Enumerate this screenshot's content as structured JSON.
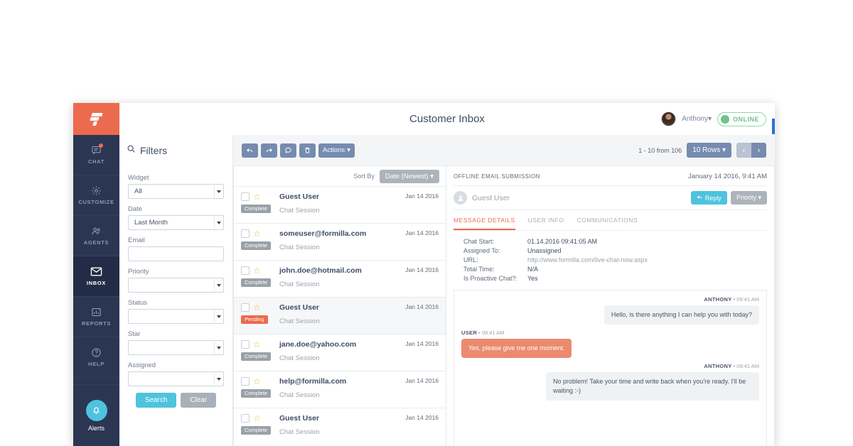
{
  "brand": {
    "accent": "#ec6a4d",
    "teal": "#4ec3dd",
    "navy": "#2b3653",
    "logo_name": "formilla-logo"
  },
  "sidebar": {
    "items": [
      {
        "label": "CHAT",
        "icon": "chat-bubble-icon",
        "active": false,
        "dot": true
      },
      {
        "label": "CUSTOMIZE",
        "icon": "gear-icon",
        "active": false,
        "dot": false
      },
      {
        "label": "AGENTS",
        "icon": "agents-icon",
        "active": false,
        "dot": false
      },
      {
        "label": "INBOX",
        "icon": "envelope-icon",
        "active": true,
        "dot": false
      },
      {
        "label": "REPORTS",
        "icon": "bar-chart-icon",
        "active": false,
        "dot": false
      },
      {
        "label": "HELP",
        "icon": "question-circle-icon",
        "active": false,
        "dot": false
      }
    ],
    "alerts": {
      "label": "Alerts",
      "icon": "bell-icon"
    }
  },
  "topbar": {
    "title": "Customer Inbox",
    "user_name": "Anthony",
    "user_caret": "▾",
    "status_text": "ONLINE"
  },
  "filters": {
    "title": "Filters",
    "search_icon": "search-icon",
    "fields": [
      {
        "label": "Widget",
        "type": "select",
        "value": "All"
      },
      {
        "label": "Date",
        "type": "select",
        "value": "Last Month"
      },
      {
        "label": "Email",
        "type": "text",
        "value": "",
        "placeholder": ""
      },
      {
        "label": "Priority",
        "type": "select",
        "value": ""
      },
      {
        "label": "Status",
        "type": "select",
        "value": ""
      },
      {
        "label": "Star",
        "type": "select",
        "value": ""
      },
      {
        "label": "Assigned",
        "type": "select",
        "value": ""
      }
    ],
    "search_button": "Search",
    "clear_button": "Clear"
  },
  "toolbar": {
    "buttons": [
      {
        "name": "reply-arrow-icon",
        "glyph": "↰"
      },
      {
        "name": "forward-arrow-icon",
        "glyph": "↱"
      },
      {
        "name": "comment-icon",
        "glyph": "◯"
      },
      {
        "name": "trash-icon",
        "glyph": "☒"
      }
    ],
    "actions_label": "Actions",
    "caret": "▾",
    "range_text": "1 - 10 from 106",
    "rows_label": "10 Rows",
    "prev_glyph": "‹",
    "next_glyph": "›"
  },
  "list": {
    "sort_label": "Sort By",
    "sort_value": "Date (Newest)",
    "sort_caret": "▾",
    "rows": [
      {
        "name": "Guest User",
        "sub": "Chat Session",
        "date": "Jan 14 2016",
        "badge": "Complete",
        "badge_kind": "complete",
        "selected": false
      },
      {
        "name": "someuser@formilla.com",
        "sub": "Chat Session",
        "date": "Jan 14 2016",
        "badge": "Complete",
        "badge_kind": "complete",
        "selected": false
      },
      {
        "name": "john.doe@hotmail.com",
        "sub": "Chat Session",
        "date": "Jan 14 2016",
        "badge": "Complete",
        "badge_kind": "complete",
        "selected": false
      },
      {
        "name": "Guest User",
        "sub": "Chat Session",
        "date": "Jan 14 2016",
        "badge": "Pending",
        "badge_kind": "pending",
        "selected": true
      },
      {
        "name": "jane.doe@yahoo.com",
        "sub": "Chat Session",
        "date": "Jan 14 2016",
        "badge": "Complete",
        "badge_kind": "complete",
        "selected": false
      },
      {
        "name": "help@formilla.com",
        "sub": "Chat Session",
        "date": "Jan 14 2016",
        "badge": "Complete",
        "badge_kind": "complete",
        "selected": false
      },
      {
        "name": "Guest User",
        "sub": "Chat Session",
        "date": "Jan 14 2016",
        "badge": "Complete",
        "badge_kind": "complete",
        "selected": false
      }
    ]
  },
  "detail": {
    "kicker": "OFFLINE EMAIL SUBMISSION",
    "timestamp": "January 14 2016, 9:41 AM",
    "user_name": "Guest User",
    "reply_label": "Reply",
    "reply_icon": "reply-arrow-icon",
    "priority_label": "Priority",
    "priority_caret": "▾",
    "tabs": [
      {
        "label": "MESSAGE DETAILS",
        "active": true
      },
      {
        "label": "USER INFO",
        "active": false
      },
      {
        "label": "COMMUNICATIONS",
        "active": false
      }
    ],
    "meta": [
      {
        "key": "Chat Start:",
        "value": "01.14.2016 09:41:05 AM",
        "link": false
      },
      {
        "key": "Assigned To:",
        "value": "Unassigned",
        "link": false
      },
      {
        "key": "URL:",
        "value": "http://www.formilla.com/live-chat-now.aspx",
        "link": true
      },
      {
        "key": "Total Time:",
        "value": "N/A",
        "link": false
      },
      {
        "key": "Is Proactive Chat?:",
        "value": "Yes",
        "link": false
      }
    ],
    "messages": [
      {
        "sender": "ANTHONY",
        "time": "09:41 AM",
        "side": "agent",
        "text": "Hello, is there anything I can help you with today?"
      },
      {
        "sender": "USER",
        "time": "09:41 AM",
        "side": "user",
        "text": "Yes, please give me one moment."
      },
      {
        "sender": "ANTHONY",
        "time": "09:41 AM",
        "side": "agent",
        "text": "No problem! Take your time and write back when you're ready. I'll be waiting :-)"
      }
    ]
  }
}
